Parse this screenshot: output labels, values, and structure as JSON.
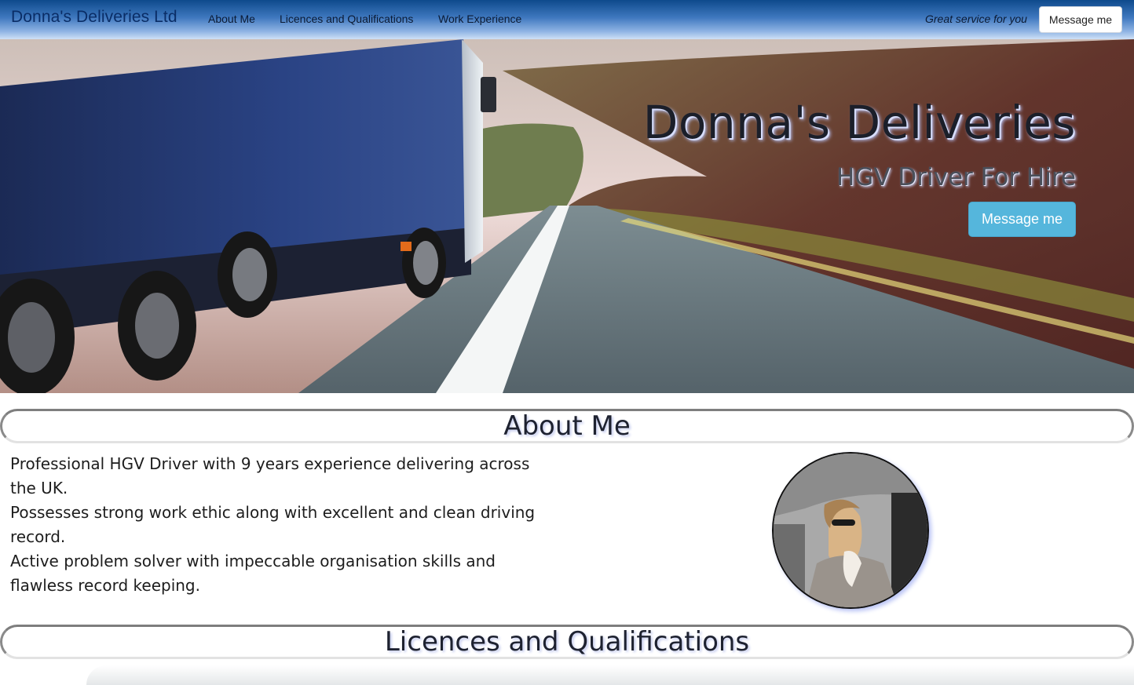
{
  "navbar": {
    "brand": "Donna's Deliveries Ltd",
    "links": [
      "About Me",
      "Licences and Qualifications",
      "Work Experience"
    ],
    "tagline": "Great service for you",
    "button": "Message me"
  },
  "hero": {
    "title": "Donna's Deliveries",
    "subtitle": "HGV Driver For Hire",
    "button": "Message me"
  },
  "about": {
    "heading": "About Me",
    "paragraphs": [
      "Professional HGV Driver with 9 years experience delivering across the UK.",
      "Possesses strong work ethic along with excellent and clean driving record.",
      "Active problem solver with impeccable organisation skills and flawless record keeping."
    ]
  },
  "licences": {
    "heading": "Licences and Qualifications"
  }
}
